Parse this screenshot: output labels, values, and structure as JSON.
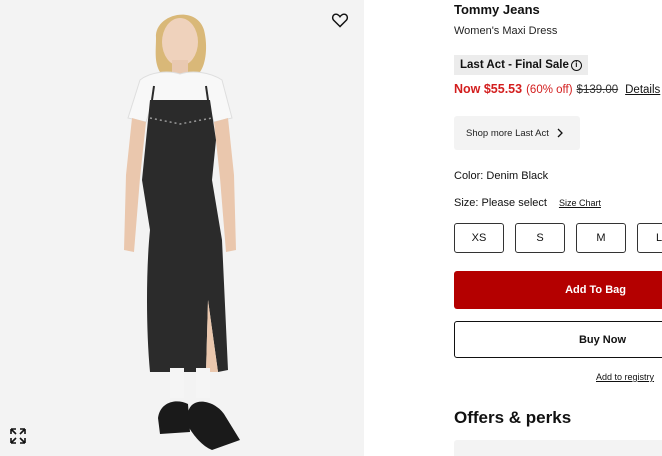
{
  "product": {
    "brand": "Tommy Jeans",
    "name": "Women's Maxi Dress",
    "final_sale_label": "Last Act - Final Sale",
    "sale_price": "Now $55.53",
    "discount": "(60% off)",
    "original_price": "$139.00",
    "details_label": "Details",
    "shop_more_label": "Shop more Last Act",
    "color_label": "Color: Denim Black",
    "size_label": "Size: Please select",
    "size_chart_label": "Size Chart",
    "sizes": [
      "XS",
      "S",
      "M",
      "L"
    ]
  },
  "actions": {
    "add_to_bag": "Add To Bag",
    "buy_now": "Buy Now",
    "add_to_registry": "Add to registry"
  },
  "offers": {
    "title": "Offers & perks"
  },
  "icons": {
    "favorite": "heart-outline-icon",
    "expand": "expand-arrows-icon",
    "info": "info-circle-icon",
    "shop_more": "chevron-right-icon"
  },
  "colors": {
    "sale_red": "#d31e1e",
    "add_to_bag_bg": "#b40000"
  }
}
